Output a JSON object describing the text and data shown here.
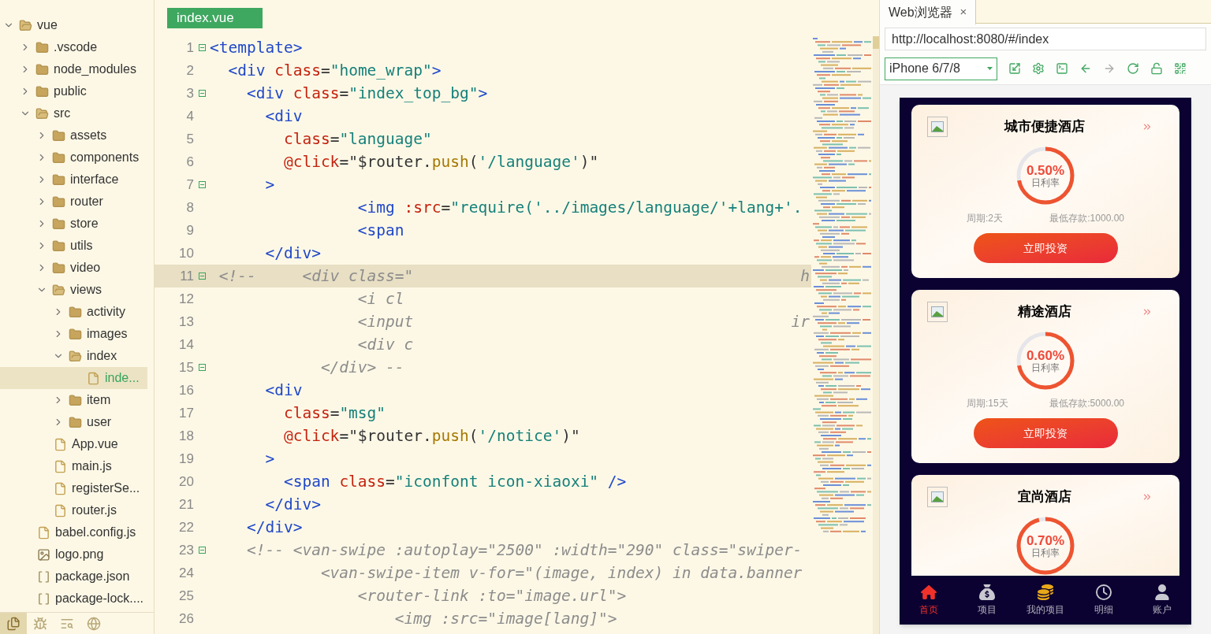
{
  "file_tree": [
    {
      "name": "vue",
      "kind": "root",
      "expanded": true,
      "selected": false,
      "children": [
        {
          "name": ".vscode",
          "kind": "folder",
          "expanded": false,
          "selected": false
        },
        {
          "name": "node_modules",
          "kind": "folder",
          "expanded": false,
          "selected": false
        },
        {
          "name": "public",
          "kind": "folder",
          "expanded": false,
          "selected": false
        },
        {
          "name": "src",
          "kind": "folder",
          "expanded": true,
          "selected": false,
          "children": [
            {
              "name": "assets",
              "kind": "folder",
              "expanded": false,
              "selected": false
            },
            {
              "name": "components",
              "kind": "folder",
              "expanded": false,
              "selected": false
            },
            {
              "name": "interface",
              "kind": "folder",
              "expanded": false,
              "selected": false
            },
            {
              "name": "router",
              "kind": "folder",
              "expanded": false,
              "selected": false
            },
            {
              "name": "store",
              "kind": "folder",
              "expanded": false,
              "selected": false
            },
            {
              "name": "utils",
              "kind": "folder",
              "expanded": false,
              "selected": false
            },
            {
              "name": "video",
              "kind": "folder",
              "expanded": false,
              "selected": false
            },
            {
              "name": "views",
              "kind": "folder",
              "expanded": true,
              "selected": false,
              "children": [
                {
                  "name": "activity",
                  "kind": "folder",
                  "expanded": false,
                  "selected": false
                },
                {
                  "name": "images",
                  "kind": "folder",
                  "expanded": false,
                  "selected": false
                },
                {
                  "name": "index",
                  "kind": "folder",
                  "expanded": true,
                  "selected": false,
                  "children": [
                    {
                      "name": "inde...",
                      "kind": "vue",
                      "selected": true
                    }
                  ]
                },
                {
                  "name": "item",
                  "kind": "folder",
                  "expanded": false,
                  "selected": false
                },
                {
                  "name": "user",
                  "kind": "folder",
                  "expanded": false,
                  "selected": false
                }
              ]
            },
            {
              "name": "App.vue",
              "kind": "vue",
              "selected": false
            },
            {
              "name": "main.js",
              "kind": "js",
              "selected": false
            },
            {
              "name": "registerSe...",
              "kind": "js",
              "selected": false
            },
            {
              "name": "router.js",
              "kind": "js",
              "selected": false
            }
          ]
        },
        {
          "name": "babel.config.js",
          "kind": "js",
          "selected": false
        },
        {
          "name": "logo.png",
          "kind": "image",
          "selected": false
        },
        {
          "name": "package.json",
          "kind": "json",
          "selected": false
        },
        {
          "name": "package-lock....",
          "kind": "json",
          "selected": false
        }
      ]
    }
  ],
  "sidebar_tools": [
    {
      "kind": "files",
      "selected": true
    },
    {
      "kind": "debug",
      "selected": false
    },
    {
      "kind": "search",
      "selected": false
    },
    {
      "kind": "web",
      "selected": false
    }
  ],
  "editor": {
    "tab": "index.vue",
    "lines": [
      {
        "number": "1",
        "text": "<template>",
        "fold": true,
        "kind": "code"
      },
      {
        "number": "2",
        "text": "  <div class=\"home_wrap\">",
        "fold": false,
        "kind": "code"
      },
      {
        "number": "3",
        "text": "    <div class=\"index_top_bg\">",
        "fold": true,
        "kind": "code"
      },
      {
        "number": "4",
        "text": "      <div",
        "fold": false,
        "kind": "code"
      },
      {
        "number": "5",
        "text": "        class=\"language\"",
        "fold": false,
        "kind": "code"
      },
      {
        "number": "6",
        "text": "        @click=\"$router.push('/language')\"",
        "fold": false,
        "kind": "code"
      },
      {
        "number": "7",
        "text": "      >",
        "fold": true,
        "kind": "code"
      },
      {
        "number": "8",
        "text": "                <img :src=\"require('../images/language/'+lang+'.",
        "fold": false,
        "kind": "code"
      },
      {
        "number": "9",
        "text": "                <span",
        "fold": false,
        "kind": "code"
      },
      {
        "number": "10",
        "text": "      </div>",
        "fold": false,
        "kind": "code"
      },
      {
        "number": "11",
        "text": " <!--     <div class=\"",
        "right": "h",
        "fold": true,
        "kind": "comment",
        "highlighted": true
      },
      {
        "number": "12",
        "text": "                <i cl",
        "fold": false,
        "kind": "comment"
      },
      {
        "number": "13",
        "text": "                <input",
        "right": "ir",
        "fold": false,
        "kind": "comment"
      },
      {
        "number": "14",
        "text": "                <div c",
        "fold": false,
        "kind": "comment"
      },
      {
        "number": "15",
        "text": "            </div> --",
        "fold": true,
        "kind": "comment"
      },
      {
        "number": "16",
        "text": "      <div",
        "fold": false,
        "kind": "code"
      },
      {
        "number": "17",
        "text": "        class=\"msg\"",
        "fold": false,
        "kind": "code"
      },
      {
        "number": "18",
        "text": "        @click=\"$router.push('/notice')\"",
        "fold": false,
        "kind": "code"
      },
      {
        "number": "19",
        "text": "      >",
        "fold": false,
        "kind": "code"
      },
      {
        "number": "20",
        "text": "        <span class=\"iconfont icon-xiaoxi\" />",
        "fold": false,
        "kind": "code"
      },
      {
        "number": "21",
        "text": "      </div>",
        "fold": false,
        "kind": "code"
      },
      {
        "number": "22",
        "text": "    </div>",
        "fold": false,
        "kind": "code"
      },
      {
        "number": "23",
        "text": "    <!-- <van-swipe :autoplay=\"2500\" :width=\"290\" class=\"swiper-",
        "fold": true,
        "kind": "comment"
      },
      {
        "number": "24",
        "text": "            <van-swipe-item v-for=\"(image, index) in data.banner",
        "fold": false,
        "kind": "comment"
      },
      {
        "number": "25",
        "text": "                <router-link :to=\"image.url\">",
        "fold": false,
        "kind": "comment"
      },
      {
        "number": "26",
        "text": "                    <img :src=\"image[lang]\">",
        "fold": false,
        "kind": "comment"
      }
    ]
  },
  "browser": {
    "tab": "Web浏览器",
    "close": "×",
    "url": "http://localhost:8080/#/index",
    "device": "iPhone 6/7/8",
    "toolbar": [
      {
        "kind": "resize",
        "disabled": false
      },
      {
        "kind": "settings",
        "disabled": false
      },
      {
        "kind": "console",
        "disabled": false
      },
      {
        "kind": "back",
        "disabled": false
      },
      {
        "kind": "forward",
        "disabled": true
      },
      {
        "kind": "reload",
        "disabled": false
      },
      {
        "kind": "lock",
        "disabled": false
      },
      {
        "kind": "qrcode",
        "disabled": false
      }
    ]
  },
  "phone": {
    "cards": [
      {
        "title": "城市便捷酒店",
        "rate": "0.50%",
        "rate_label": "日利率",
        "level": 0.72,
        "period": "周期:2天",
        "minimum": "最低存款:1000.00",
        "button": "立即投资"
      },
      {
        "title": "精途酒店",
        "rate": "0.60%",
        "rate_label": "日利率",
        "level": 0.72,
        "period": "周期:15天",
        "minimum": "最低存款:5000.00",
        "button": "立即投资"
      },
      {
        "title": "宜尚酒店",
        "rate": "0.70%",
        "rate_label": "日利率",
        "level": 0.96
      }
    ],
    "nav": [
      {
        "label": "首页",
        "kind": "home",
        "selected": true
      },
      {
        "label": "项目",
        "kind": "bag",
        "selected": false
      },
      {
        "label": "我的项目",
        "kind": "coins",
        "selected": false
      },
      {
        "label": "明细",
        "kind": "clock",
        "selected": false
      },
      {
        "label": "账户",
        "kind": "user",
        "selected": false
      }
    ]
  }
}
